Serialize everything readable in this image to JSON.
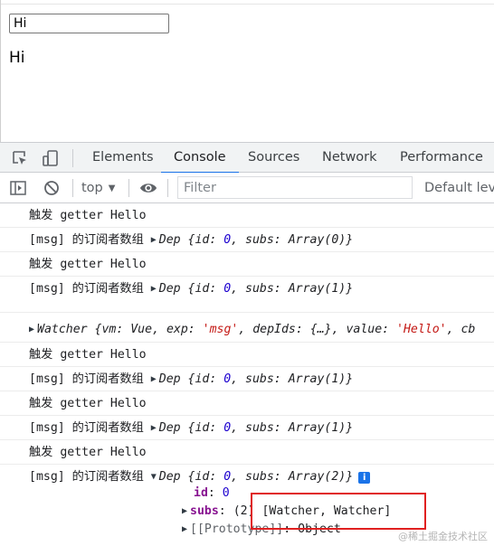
{
  "page": {
    "input_value": "Hi",
    "output_text": "Hi"
  },
  "devtools": {
    "tabs": [
      "Elements",
      "Console",
      "Sources",
      "Network",
      "Performance"
    ],
    "active_tab": "Console",
    "toolbar": {
      "context": "top",
      "filter_placeholder": "Filter",
      "levels_label": "Default leve"
    },
    "console": {
      "trigger_text": "触发 getter Hello",
      "subscriber_label": "[msg] 的订阅者数组",
      "dep_object_prefix": "Dep {id: ",
      "dep_id": "0",
      "dep_subs_part": ", subs: ",
      "array_0": "Array(0)",
      "array_1": "Array(1)",
      "array_2": "Array(2)",
      "close_brace": "}",
      "watcher_text_1": "Watcher {vm: Vue, exp: ",
      "watcher_exp": "'msg'",
      "watcher_text_2": ", depIds: {…}, value: ",
      "watcher_value": "'Hello'",
      "watcher_text_3": ", cb",
      "expanded": {
        "id_key": "id",
        "id_value": "0",
        "subs_key": "subs",
        "subs_value": "(2) [Watcher, Watcher]",
        "proto_key": "[[Prototype]]",
        "proto_value": ": Object"
      }
    }
  },
  "watermark": "@稀土掘金技术社区",
  "colors": {
    "accent": "#1a73e8",
    "highlight_box": "#e02020",
    "key_purple": "#881391",
    "string_red": "#c41a16",
    "number_blue": "#1c00cf"
  }
}
